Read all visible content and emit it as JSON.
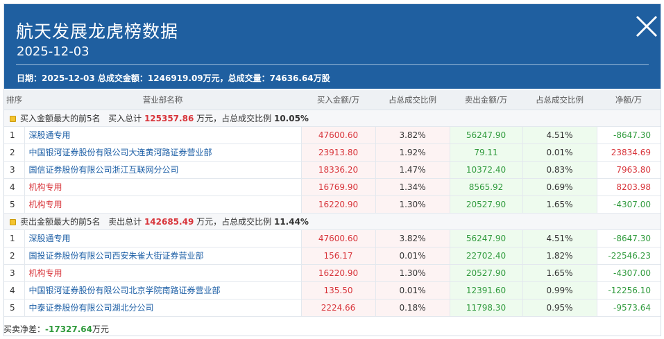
{
  "header": {
    "title": "航天发展龙虎榜数据",
    "date": "2025-12-03",
    "summary": "日期：2025-12-03 总成交金额：1246919.09万元，总成交量：74636.64万股"
  },
  "columns": [
    "排序",
    "营业部名称",
    "买入金额/万",
    "占总成交比例",
    "卖出金额/万",
    "占总成交比例",
    "净额/万"
  ],
  "buy_group": {
    "label": "买入金额最大的前5名",
    "total_prefix": "买入总计",
    "total_value": "125357.86",
    "total_suffix": "万元，占总成交比例",
    "pct": "10.05%"
  },
  "buy_rows": [
    {
      "idx": "1",
      "name": "深股通专用",
      "name_color": "blue",
      "buy": "47600.60",
      "buy_pct": "3.82%",
      "sell": "56247.90",
      "sell_pct": "4.51%",
      "net": "-8647.30",
      "net_color": "green"
    },
    {
      "idx": "2",
      "name": "中国银河证券股份有限公司大连黄河路证券营业部",
      "name_color": "blue",
      "buy": "23913.80",
      "buy_pct": "1.92%",
      "sell": "79.11",
      "sell_pct": "0.01%",
      "net": "23834.69",
      "net_color": "red"
    },
    {
      "idx": "3",
      "name": "国信证券股份有限公司浙江互联网分公司",
      "name_color": "blue",
      "buy": "18336.20",
      "buy_pct": "1.47%",
      "sell": "10372.40",
      "sell_pct": "0.83%",
      "net": "7963.80",
      "net_color": "red"
    },
    {
      "idx": "4",
      "name": "机构专用",
      "name_color": "red",
      "buy": "16769.90",
      "buy_pct": "1.34%",
      "sell": "8565.92",
      "sell_pct": "0.69%",
      "net": "8203.98",
      "net_color": "red"
    },
    {
      "idx": "5",
      "name": "机构专用",
      "name_color": "red",
      "buy": "16220.90",
      "buy_pct": "1.30%",
      "sell": "20527.90",
      "sell_pct": "1.65%",
      "net": "-4307.00",
      "net_color": "green"
    }
  ],
  "sell_group": {
    "label": "卖出金额最大的前5名",
    "total_prefix": "卖出总计",
    "total_value": "142685.49",
    "total_suffix": "万元，占总成交比例",
    "pct": "11.44%"
  },
  "sell_rows": [
    {
      "idx": "1",
      "name": "深股通专用",
      "name_color": "blue",
      "buy": "47600.60",
      "buy_pct": "3.82%",
      "sell": "56247.90",
      "sell_pct": "4.51%",
      "net": "-8647.30",
      "net_color": "green"
    },
    {
      "idx": "2",
      "name": "国投证券股份有限公司西安朱雀大街证券营业部",
      "name_color": "blue",
      "buy": "156.17",
      "buy_pct": "0.01%",
      "sell": "22702.40",
      "sell_pct": "1.82%",
      "net": "-22546.23",
      "net_color": "green"
    },
    {
      "idx": "3",
      "name": "机构专用",
      "name_color": "red",
      "buy": "16220.90",
      "buy_pct": "1.30%",
      "sell": "20527.90",
      "sell_pct": "1.65%",
      "net": "-4307.00",
      "net_color": "green"
    },
    {
      "idx": "4",
      "name": "中国银河证券股份有限公司北京学院南路证券营业部",
      "name_color": "blue",
      "buy": "135.50",
      "buy_pct": "0.01%",
      "sell": "12391.60",
      "sell_pct": "0.99%",
      "net": "-12256.10",
      "net_color": "green"
    },
    {
      "idx": "5",
      "name": "中泰证券股份有限公司湖北分公司",
      "name_color": "blue",
      "buy": "2224.66",
      "buy_pct": "0.18%",
      "sell": "11798.30",
      "sell_pct": "0.95%",
      "net": "-9573.64",
      "net_color": "green"
    }
  ],
  "footer": {
    "label": "买卖净差：",
    "value": "-17327.64",
    "unit": "万元"
  },
  "colors": {
    "header_bg": "#1f5fa0",
    "red": "#d8353b",
    "green": "#2f9a3c",
    "blue": "#1d5fa6"
  },
  "icons": {
    "close": "close-icon",
    "group": "folder-icon"
  }
}
